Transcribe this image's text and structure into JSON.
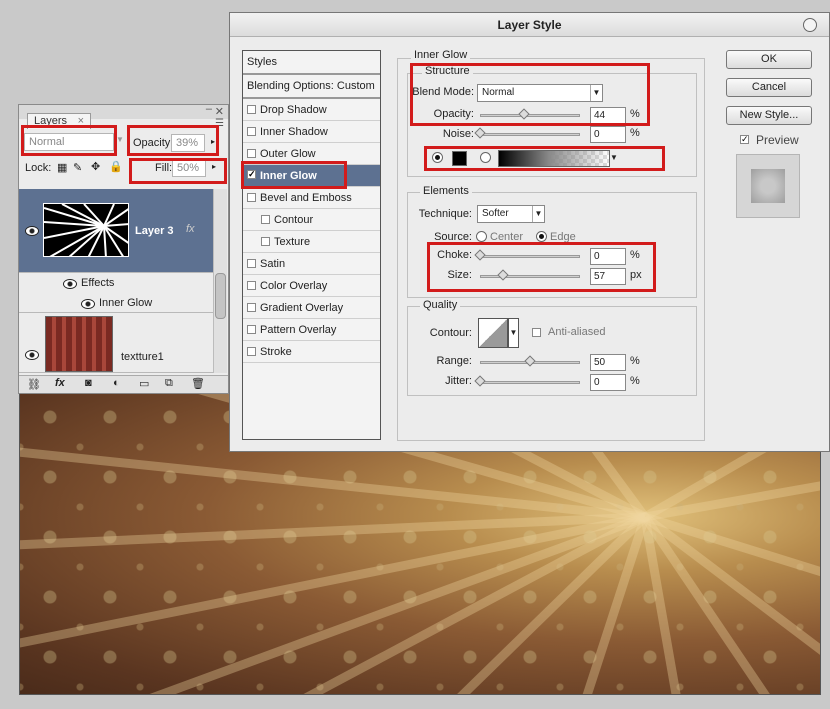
{
  "layers_panel": {
    "tab_label": "Layers",
    "blend_mode": "Normal",
    "opacity_label": "Opacity:",
    "opacity_value": "39%",
    "lock_label": "Lock:",
    "fill_label": "Fill:",
    "fill_value": "50%",
    "layers": [
      {
        "name": "Layer 3",
        "fx": "fx"
      },
      {
        "name": "Effects"
      },
      {
        "name": "Inner Glow"
      },
      {
        "name": "textture1"
      }
    ]
  },
  "dialog": {
    "title": "Layer Style",
    "styles_header": "Styles",
    "blending_options": "Blending Options: Custom",
    "style_items": [
      {
        "label": "Drop Shadow",
        "checked": false
      },
      {
        "label": "Inner Shadow",
        "checked": false
      },
      {
        "label": "Outer Glow",
        "checked": false
      },
      {
        "label": "Inner Glow",
        "checked": true
      },
      {
        "label": "Bevel and Emboss",
        "checked": false
      },
      {
        "label": "Contour",
        "checked": false
      },
      {
        "label": "Texture",
        "checked": false
      },
      {
        "label": "Satin",
        "checked": false
      },
      {
        "label": "Color Overlay",
        "checked": false
      },
      {
        "label": "Gradient Overlay",
        "checked": false
      },
      {
        "label": "Pattern Overlay",
        "checked": false
      },
      {
        "label": "Stroke",
        "checked": false
      }
    ],
    "inner_glow": {
      "section_title": "Inner Glow",
      "structure_title": "Structure",
      "blend_mode_label": "Blend Mode:",
      "blend_mode_value": "Normal",
      "opacity_label": "Opacity:",
      "opacity_value": "44",
      "opacity_unit": "%",
      "noise_label": "Noise:",
      "noise_value": "0",
      "noise_unit": "%"
    },
    "elements": {
      "title": "Elements",
      "technique_label": "Technique:",
      "technique_value": "Softer",
      "source_label": "Source:",
      "source_center": "Center",
      "source_edge": "Edge",
      "choke_label": "Choke:",
      "choke_value": "0",
      "choke_unit": "%",
      "size_label": "Size:",
      "size_value": "57",
      "size_unit": "px"
    },
    "quality": {
      "title": "Quality",
      "contour_label": "Contour:",
      "anti_aliased": "Anti-aliased",
      "range_label": "Range:",
      "range_value": "50",
      "range_unit": "%",
      "jitter_label": "Jitter:",
      "jitter_value": "0",
      "jitter_unit": "%"
    },
    "buttons": {
      "ok": "OK",
      "cancel": "Cancel",
      "new_style": "New Style...",
      "preview": "Preview"
    },
    "slider_levels": {
      "opacity": 0.44,
      "noise": 0,
      "choke": 0,
      "size": 0.23,
      "range": 0.5,
      "jitter": 0
    }
  },
  "colors": {
    "highlight_red": "#d21b1b",
    "selected_layer": "#5d7191",
    "glow_color": "#000000"
  }
}
